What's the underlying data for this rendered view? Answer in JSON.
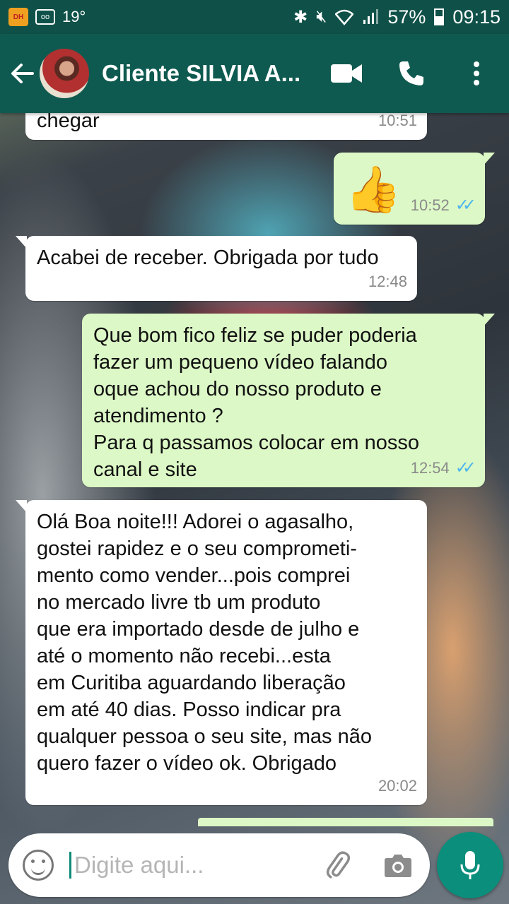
{
  "status_bar": {
    "temperature": "19°",
    "battery": "57%",
    "time": "09:15"
  },
  "header": {
    "contact_name": "Cliente SILVIA A..."
  },
  "messages": [
    {
      "direction": "in",
      "text": "chegar",
      "time": "10:51"
    },
    {
      "direction": "out",
      "text": "👍",
      "time": "10:52",
      "read": true
    },
    {
      "direction": "in",
      "text": "Acabei de receber. Obrigada por tudo",
      "time": "12:48"
    },
    {
      "direction": "out",
      "text": "Que bom  fico feliz se puder poderia\nfazer um pequeno vídeo falando\noque achou do nosso produto e\natendimento ?\nPara q passamos colocar em nosso\ncanal e site",
      "time": "12:54",
      "read": true
    },
    {
      "direction": "in",
      "text": "Olá Boa noite!!! Adorei o agasalho,\ngostei rapidez  e o seu comprometi-\nmento  como vender...pois comprei\nno mercado  livre tb um produto\nque era importado desde de julho e\naté o momento  não  recebi...esta\nem Curitiba  aguardando liberação\nem até 40 dias. Posso indicar  pra\nqualquer  pessoa  o seu site, mas não\nquero  fazer  o vídeo ok. Obrigado",
      "time": "20:02"
    }
  ],
  "composer": {
    "placeholder": "Digite aqui..."
  },
  "colors": {
    "header": "#0f5a50",
    "status_bar": "#0f5148",
    "outgoing_bubble": "#dcf8c6",
    "incoming_bubble": "#ffffff",
    "read_tick": "#4fb6ec",
    "mic_button": "#0b8f7c"
  },
  "icons": [
    "back-arrow-icon",
    "video-call-icon",
    "phone-icon",
    "more-options-icon",
    "emoji-icon",
    "attach-icon",
    "camera-icon",
    "mic-icon"
  ]
}
